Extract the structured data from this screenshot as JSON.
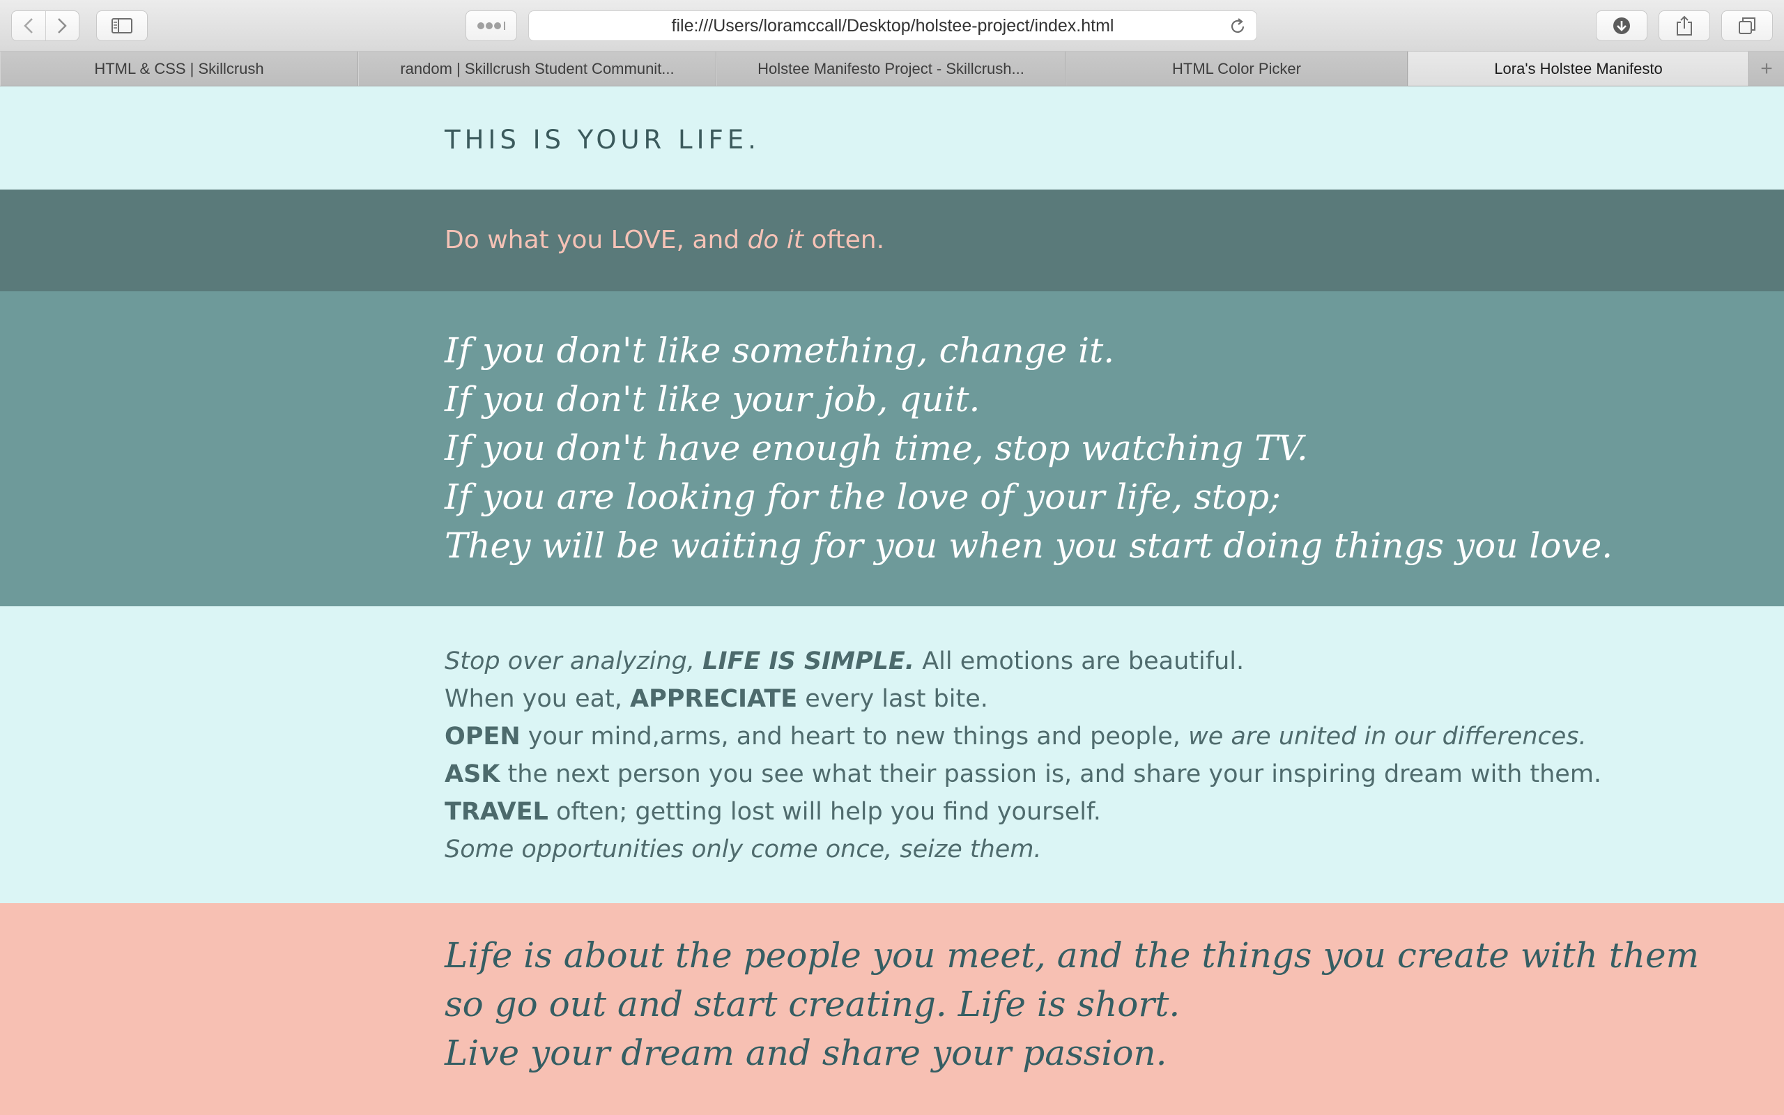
{
  "browser": {
    "url": "file:///Users/loramccall/Desktop/holstee-project/index.html",
    "tabs": [
      {
        "label": "HTML & CSS | Skillcrush"
      },
      {
        "label": "random | Skillcrush Student Communit..."
      },
      {
        "label": "Holstee Manifesto Project - Skillcrush..."
      },
      {
        "label": "HTML Color Picker"
      },
      {
        "label": "Lora's Holstee Manifesto"
      }
    ],
    "new_tab_label": "+"
  },
  "manifesto": {
    "heading": "THIS IS YOUR LIFE.",
    "love": {
      "before": "Do what you LOVE, and ",
      "emph": "do it",
      "after": " often."
    },
    "script_lines": [
      "If you don't like something, change it.",
      "If you don't like your job, quit.",
      "If you don't have enough time, stop watching TV.",
      "If you are looking for the love of your life, stop;",
      "They will be waiting for you when you start doing things you love."
    ],
    "body": {
      "r1_em": "Stop over analyzing, ",
      "r1_strong": "LIFE IS SIMPLE.",
      "r1_rest": " All emotions are beautiful.",
      "r2_pre": "When you eat, ",
      "r2_strong": "APPRECIATE",
      "r2_rest": " every last bite.",
      "r3_strong": "OPEN",
      "r3_rest": " your mind,arms, and heart to new things and people, ",
      "r3_em": "we are united in our differences.",
      "r4_strong": "ASK",
      "r4_rest": " the next person you see what their passion is, and share your inspiring dream with them.",
      "r5_strong": "TRAVEL",
      "r5_rest": " often; getting lost will help you find yourself.",
      "r6_em": "Some opportunities only come once, seize them."
    },
    "closing_lines": [
      "Life is about the people you meet, and the things you create with them",
      "so go out and start creating. Life is short.",
      "Live your dream and share your passion."
    ]
  },
  "colors": {
    "light_teal": "#dbf5f5",
    "dark_teal": "#5a7a7a",
    "mid_teal": "#6e9a9a",
    "salmon": "#f7c0b3",
    "pink_text": "#f6c2b6",
    "teal_text": "#355e63"
  },
  "icons": [
    "back-icon",
    "forward-icon",
    "sidebar-icon",
    "reader-icon",
    "reload-icon",
    "download-icon",
    "share-icon",
    "tabs-overview-icon",
    "plus-icon"
  ]
}
